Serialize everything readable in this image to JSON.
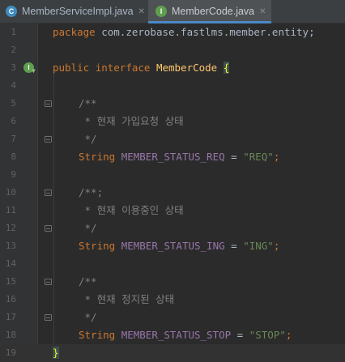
{
  "tabs": [
    {
      "label": "MemberServiceImpl.java",
      "icon": "C",
      "icon_color": "#3f8bbf",
      "active": false
    },
    {
      "label": "MemberCode.java",
      "icon": "I",
      "icon_color": "#5f9e4e",
      "active": true
    }
  ],
  "lines": [
    {
      "n": "1"
    },
    {
      "n": "2"
    },
    {
      "n": "3"
    },
    {
      "n": "4"
    },
    {
      "n": "5"
    },
    {
      "n": "6"
    },
    {
      "n": "7"
    },
    {
      "n": "8"
    },
    {
      "n": "9"
    },
    {
      "n": "10"
    },
    {
      "n": "11"
    },
    {
      "n": "12"
    },
    {
      "n": "13"
    },
    {
      "n": "14"
    },
    {
      "n": "15"
    },
    {
      "n": "16"
    },
    {
      "n": "17"
    },
    {
      "n": "18"
    },
    {
      "n": "19"
    }
  ],
  "code": {
    "l1_kw": "package",
    "l1_rest": " com.zerobase.fastlms.member.entity;",
    "l3_kw1": "public",
    "l3_kw2": "interface",
    "l3_name": "MemberCode",
    "l3_brace": "{",
    "l5": "/**",
    "l6": " * 현재 가입요청 상태",
    "l7": " */",
    "l8_type": "String",
    "l8_field": "MEMBER_STATUS_REQ",
    "l8_eq": " = ",
    "l8_val": "\"REQ\"",
    "l8_end": ";",
    "l10": "/**;",
    "l11": " * 현재 이용중인 상태",
    "l12": " */",
    "l13_type": "String",
    "l13_field": "MEMBER_STATUS_ING",
    "l13_eq": " = ",
    "l13_val": "\"ING\"",
    "l13_end": ";",
    "l15": "/**",
    "l16": " * 현재 정지된 상태",
    "l17": " */",
    "l18_type": "String",
    "l18_field": "MEMBER_STATUS_STOP",
    "l18_eq": " = ",
    "l18_val": "\"STOP\"",
    "l18_end": ";",
    "l19_brace": "}"
  },
  "icons": {
    "class_icon": "java-class-icon",
    "interface_icon": "java-interface-icon",
    "implemented_icon": "implemented-marker-icon",
    "fold_icon": "fold-marker-icon"
  },
  "colors": {
    "background": "#2b2b2b",
    "keyword": "#cc7832",
    "field": "#9876aa",
    "string": "#6a8759",
    "comment": "#808080",
    "active_tab_underline": "#4a88c7"
  }
}
